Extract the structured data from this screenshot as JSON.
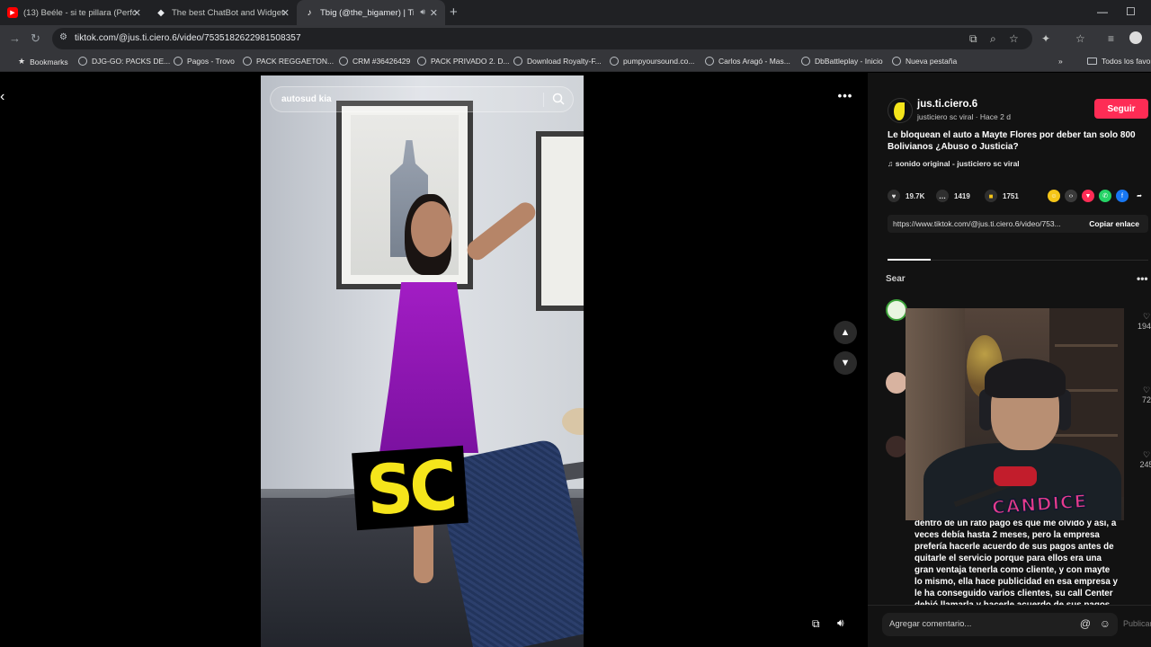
{
  "browser": {
    "tabs": [
      {
        "title": "(13) Beéle - si te pillara (Perform",
        "favicon": "youtube-icon",
        "color": "#ff0000"
      },
      {
        "title": "The best ChatBot and Widgets",
        "favicon": "diamond-icon",
        "color": "#e8eaed"
      },
      {
        "title": "Tbig (@the_bigamer) | TikTo",
        "favicon": "tiktok-icon",
        "color": "#ffffff",
        "active": true
      }
    ],
    "url": "tiktok.com/@jus.ti.ciero.6/video/7535182622981508357",
    "bookmarks": [
      "Bookmarks",
      "DJG-GO: PACKS DE...",
      "Pagos - Trovo",
      "PACK REGGAETON...",
      "CRM #36426429",
      "PACK PRIVADO 2. D...",
      "Download Royalty-F...",
      "pumpyoursound.co...",
      "Carlos Aragó - Mas...",
      "DbBattleplay - Inicio",
      "Nueva pestaña",
      "Todos los favoritos"
    ]
  },
  "video": {
    "search_placeholder": "autosud kia",
    "overlay_logo": "SC"
  },
  "post": {
    "username": "jus.ti.ciero.6",
    "subtitle": "justiciero sc viral · Hace 2 d",
    "follow_label": "Seguir",
    "description": "Le bloquean el auto a Mayte Flores por deber tan solo 800 Bolivianos ¿Abuso o Justicia?",
    "sound": "sonido original - justiciero sc viral",
    "likes": "19.7K",
    "comments": "1419",
    "saves": "1751",
    "link_text": "https://www.tiktok.com/@jus.ti.ciero.6/video/753...",
    "copy_label": "Copiar enlace",
    "search_label": "Sear",
    "comment_like_counts": [
      "1940",
      "72",
      "245"
    ],
    "comment_text": "aunque lo vean mal, mayte tiene razón, mi hermano trabajaba en una empresa que le ofrecía servicio a una presentadora de TV famosa, y para cobrar es con los call Center cobradores, ellos con paciencia la llamaban cada vez para que pague y la mujer les decía, dentro de un rato pago es que me olvidó y así, a veces debía hasta 2 meses, pero la empresa prefería hacerle acuerdo de sus pagos antes de quitarle el servicio porque para ellos era una gran ventaja tenerla como cliente, y con mayte lo mismo, ella hace publicidad en esa empresa y le ha conseguido varios clientes, su call Center debió llamarla y hacerle acuerdo de sus pagos, es un",
    "comment_placeholder": "Agregar comentario...",
    "publish_label": "Publicar"
  },
  "webcam": {
    "shirt_text": "CANDICE"
  },
  "colors": {
    "accent": "#fe2c55",
    "logo_yellow": "#f5e51b",
    "dress": "#a21dc4"
  }
}
